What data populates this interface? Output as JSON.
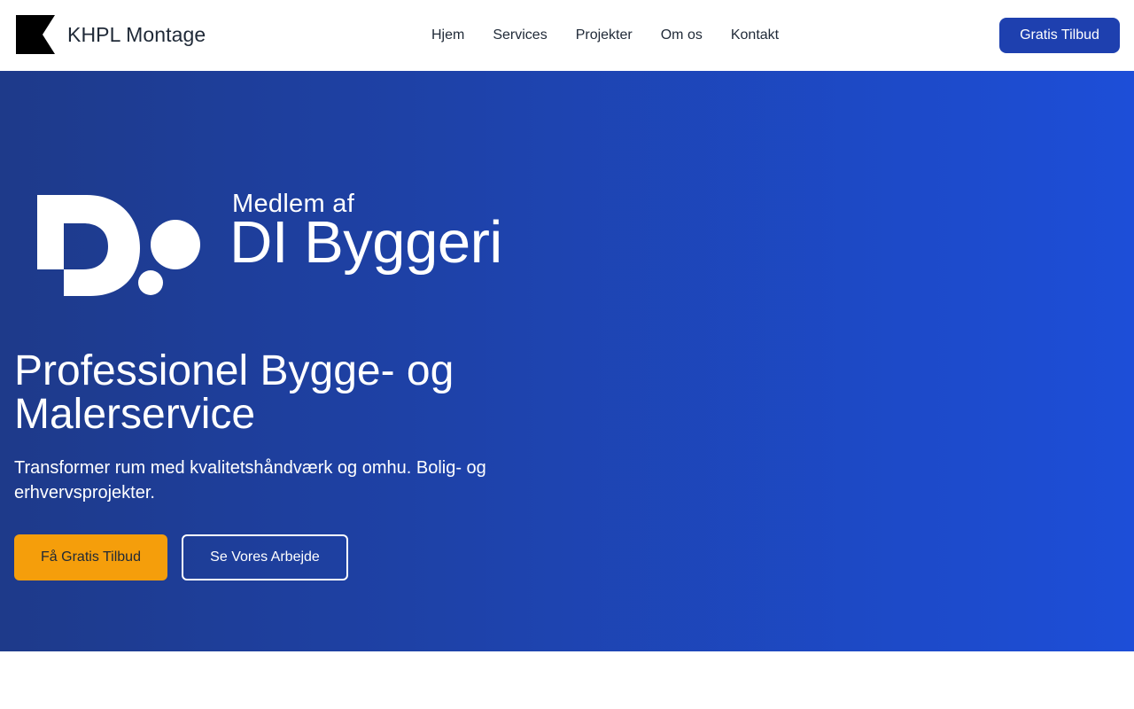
{
  "header": {
    "brand_name": "KHPL Montage",
    "logo_icon": "flag-logo-icon",
    "nav": [
      {
        "label": "Hjem"
      },
      {
        "label": "Services"
      },
      {
        "label": "Projekter"
      },
      {
        "label": "Om os"
      },
      {
        "label": "Kontakt"
      }
    ],
    "cta_label": "Gratis Tilbud"
  },
  "hero": {
    "badge": {
      "member_text": "Medlem af",
      "org_name": "DI Byggeri",
      "logo_icon": "di-logo-icon"
    },
    "title": "Professionel Bygge- og Malerservice",
    "subtitle": "Transformer rum med kvalitetshåndværk og omhu. Bolig- og erhvervsprojekter.",
    "primary_button": "Få Gratis Tilbud",
    "secondary_button": "Se Vores Arbejde"
  },
  "colors": {
    "header_bg": "#ffffff",
    "hero_gradient_start": "#1e3a8a",
    "hero_gradient_end": "#1d4ed8",
    "cta_blue": "#1e40af",
    "accent_yellow": "#f59e0b",
    "text_dark": "#1f2937"
  }
}
